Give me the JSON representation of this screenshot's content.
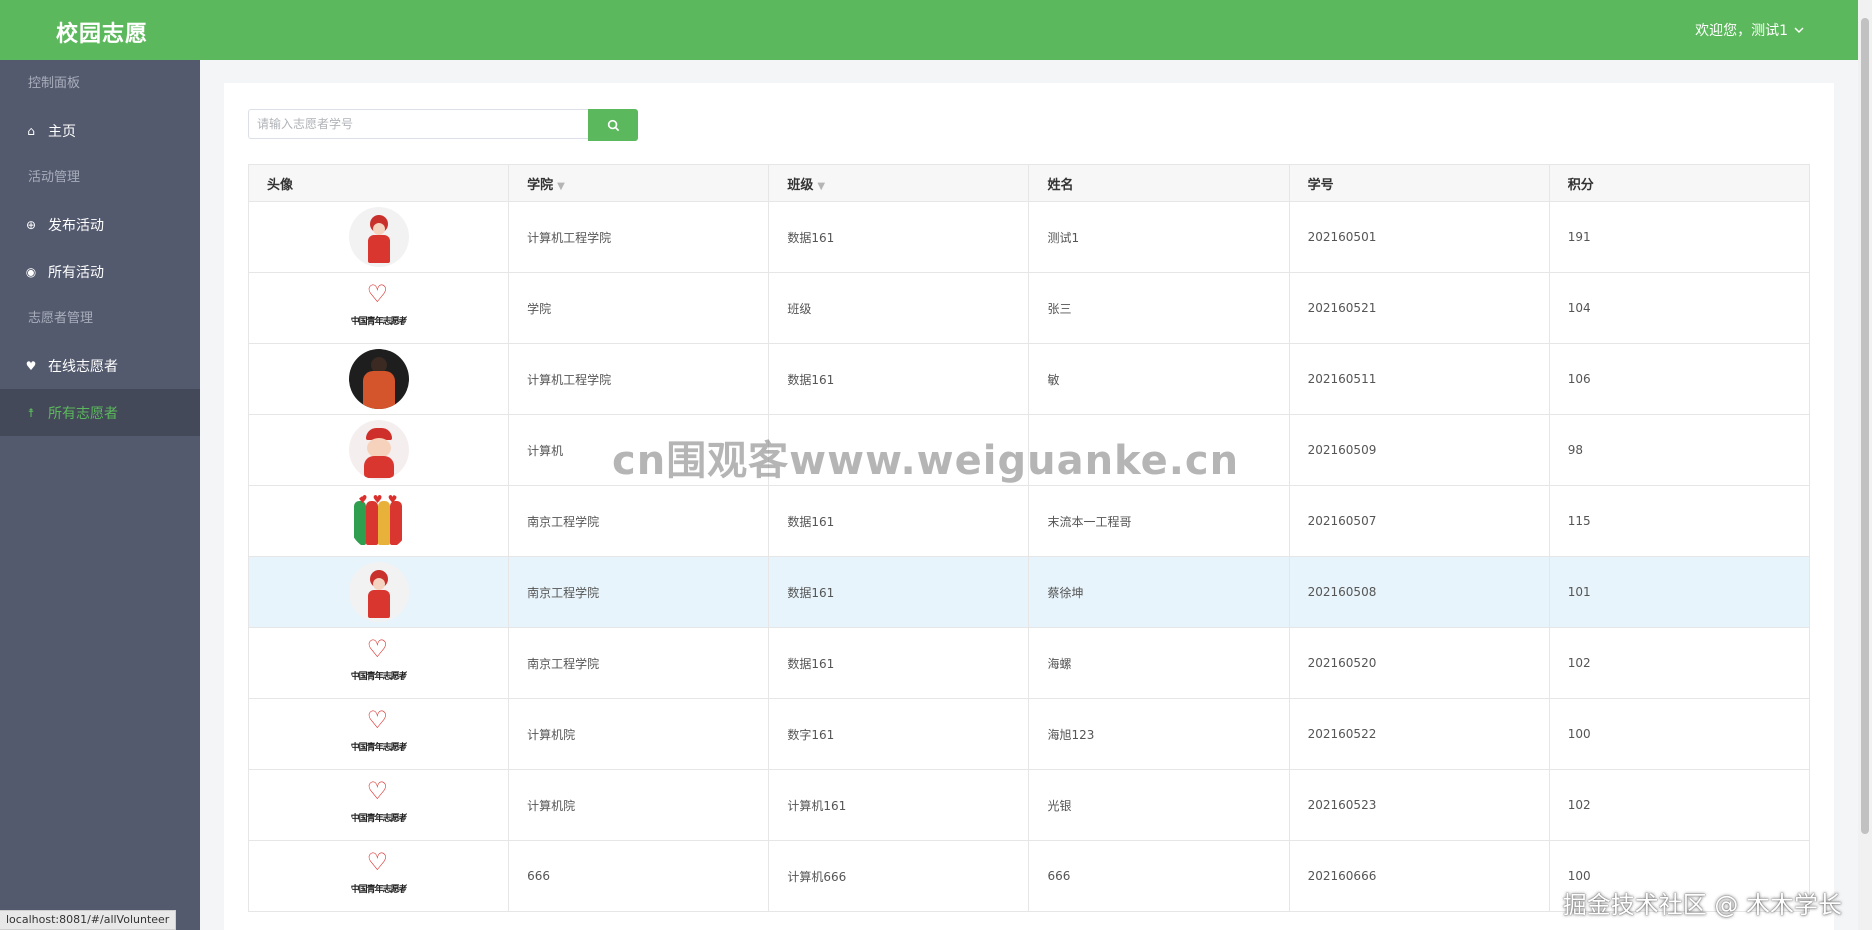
{
  "header": {
    "brand": "校园志愿",
    "user_greeting": "欢迎您，测试1",
    "accent": "#5cb85c"
  },
  "sidebar": {
    "group_dashboard": "控制面板",
    "home": "主页",
    "group_activity": "活动管理",
    "publish_activity": "发布活动",
    "all_activities": "所有活动",
    "group_volunteer": "志愿者管理",
    "online_volunteers": "在线志愿者",
    "all_volunteers": "所有志愿者"
  },
  "search": {
    "placeholder": "请输入志愿者学号"
  },
  "table": {
    "columns": [
      "头像",
      "学院",
      "班级",
      "姓名",
      "学号",
      "积分"
    ],
    "rows": [
      {
        "avatar": "girl-heart-avatar",
        "college": "计算机工程学院",
        "class": "数据161",
        "name": "测试1",
        "id": "202160501",
        "points": "191"
      },
      {
        "avatar": "china-youth-volunteer-logo",
        "college": "学院",
        "class": "班级",
        "name": "张三",
        "id": "202160521",
        "points": "104"
      },
      {
        "avatar": "volunteer-shirt-avatar",
        "college": "计算机工程学院",
        "class": "数据161",
        "name": "敏",
        "id": "202160511",
        "points": "106"
      },
      {
        "avatar": "mascot-avatar",
        "college": "计算机",
        "class": "",
        "name": "",
        "id": "202160509",
        "points": "98"
      },
      {
        "avatar": "group-volunteers-avatar",
        "college": "南京工程学院",
        "class": "数据161",
        "name": "末流本一工程哥",
        "id": "202160507",
        "points": "115"
      },
      {
        "avatar": "girl-heart-avatar",
        "college": "南京工程学院",
        "class": "数据161",
        "name": "蔡徐坤",
        "id": "202160508",
        "points": "101"
      },
      {
        "avatar": "china-youth-volunteer-logo",
        "college": "南京工程学院",
        "class": "数据161",
        "name": "海螺",
        "id": "202160520",
        "points": "102"
      },
      {
        "avatar": "china-youth-volunteer-logo",
        "college": "计算机院",
        "class": "数字161",
        "name": "海旭123",
        "id": "202160522",
        "points": "100"
      },
      {
        "avatar": "china-youth-volunteer-logo",
        "college": "计算机院",
        "class": "计算机161",
        "name": "光银",
        "id": "202160523",
        "points": "102"
      },
      {
        "avatar": "china-youth-volunteer-logo",
        "college": "666",
        "class": "计算机666",
        "name": "666",
        "id": "202160666",
        "points": "100"
      }
    ],
    "logo_text": "中国青年志愿者"
  },
  "statusbar": {
    "url": "localhost:8081/#/allVolunteer"
  },
  "watermarks": {
    "center": "cn围观客www.weiguanke.cn",
    "corner": "掘金技术社区 @ 木木学长"
  }
}
